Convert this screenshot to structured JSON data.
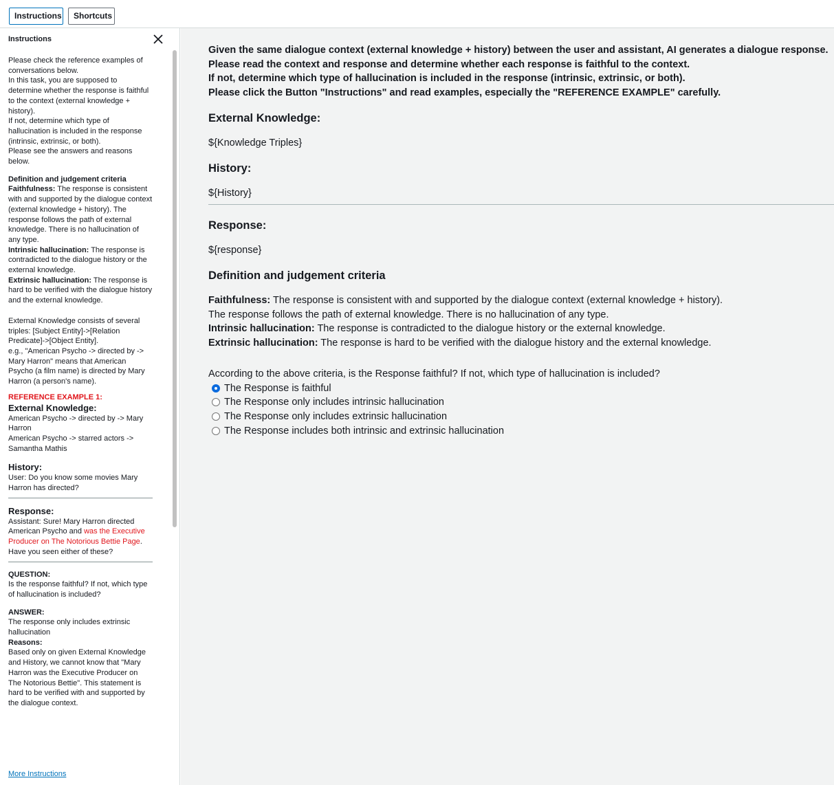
{
  "topbar": {
    "instructions_label": "Instructions",
    "shortcuts_label": "Shortcuts"
  },
  "sidebar": {
    "title": "Instructions",
    "intro": [
      "Please check the reference examples of conversations below.",
      "In this task, you are supposed to determine whether the response is faithful to the context (external knowledge + history).",
      "If not, determine which type of hallucination is included in the response (intrinsic, extrinsic, or both).",
      "Please see the answers and reasons below."
    ],
    "criteria_title": "Definition and judgement criteria",
    "faithfulness_term": "Faithfulness:",
    "faithfulness_text": " The response is consistent with and supported by the dialogue context (external knowledge + history). The response follows the path of external knowledge. There is no hallucination of any type.",
    "intrinsic_term": "Intrinsic hallucination:",
    "intrinsic_text": " The response is contradicted to the dialogue history or the external knowledge.",
    "extrinsic_term": "Extrinsic hallucination:",
    "extrinsic_text": " The response is hard to be verified with the dialogue history and the external knowledge.",
    "ek_explain_1": "External Knowledge consists of several triples: [Subject Entity]->[Relation Predicate]->[Object Entity].",
    "ek_explain_2": "e.g., \"American Psycho -> directed by -> Mary Harron\" means that American Psycho (a film name) is directed by Mary Harron (a person's name).",
    "ref_example_title": "REFERENCE EXAMPLE 1:",
    "ek_heading": "External Knowledge:",
    "ek_triple_1": "American Psycho -> directed by -> Mary Harron",
    "ek_triple_2": "American Psycho -> starred actors -> Samantha Mathis",
    "history_heading": "History:",
    "history_text": "User: Do you know some movies Mary Harron has directed?",
    "response_heading": "Response:",
    "response_text_1": "Assistant: Sure! Mary Harron directed American Psycho and ",
    "response_text_red": "was the Executive Producer on The Notorious Bettie Page",
    "response_text_2": ". Have you seen either of these?",
    "question_heading": "QUESTION:",
    "question_text": "Is the response faithful? If not, which type of hallucination is included?",
    "answer_heading": "ANSWER:",
    "answer_text": "The response only includes extrinsic hallucination",
    "reasons_heading": "Reasons:",
    "reasons_text": "Based only on given External Knowledge and History, we cannot know that \"Mary Harron was the Executive Producer on The Notorious Bettie\". This statement is hard to be verified with and supported by the dialogue context.",
    "more_link": "More Instructions"
  },
  "main": {
    "intro": [
      "Given the same dialogue context (external knowledge + history) between the user and assistant, AI generates a dialogue response.",
      "Please read the context and response and determine whether each response is faithful to the context.",
      "If not, determine which type of hallucination is included in the response (intrinsic, extrinsic, or both).",
      "Please click the Button \"Instructions\" and read examples, especially the \"REFERENCE EXAMPLE\" carefully."
    ],
    "ek_heading": "External Knowledge:",
    "ek_value": "${Knowledge Triples}",
    "history_heading": "History:",
    "history_value": "${History}",
    "response_heading": "Response:",
    "response_value": "${response}",
    "criteria_heading": "Definition and judgement criteria",
    "faithfulness_term": "Faithfulness:",
    "faithfulness_text_1": " The response is consistent with and supported by the dialogue context (external knowledge + history).",
    "faithfulness_text_2": "The response follows the path of external knowledge. There is no hallucination of any type.",
    "intrinsic_term": "Intrinsic hallucination:",
    "intrinsic_text": " The response is contradicted to the dialogue history or the external knowledge.",
    "extrinsic_term": "Extrinsic hallucination:",
    "extrinsic_text": " The response is hard to be verified with the dialogue history and the external knowledge.",
    "question": "According to the above criteria, is the Response faithful? If not, which type of hallucination is included?",
    "options": [
      {
        "label": "The Response is faithful",
        "checked": true
      },
      {
        "label": "The Response only includes intrinsic hallucination",
        "checked": false
      },
      {
        "label": "The Response only includes extrinsic hallucination",
        "checked": false
      },
      {
        "label": "The Response includes both intrinsic and extrinsic hallucination",
        "checked": false
      }
    ]
  },
  "colors": {
    "accent_blue": "#0073bb",
    "reference_red": "#e0161c",
    "radio_blue": "#0b6bde",
    "main_bg": "#f2f3f3"
  }
}
